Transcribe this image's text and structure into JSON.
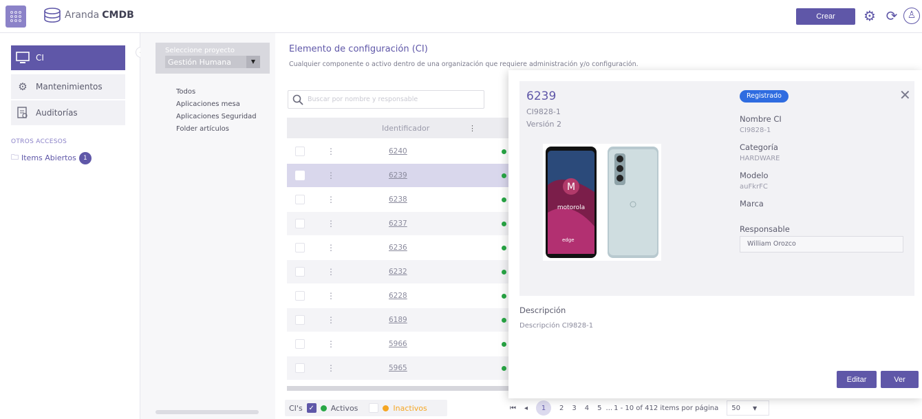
{
  "header": {
    "brand_prefix": "Aranda",
    "brand_bold": "CMDB",
    "create_label": "Crear"
  },
  "sidebar": {
    "items": [
      {
        "label": "CI",
        "icon": "monitor-icon",
        "active": true
      },
      {
        "label": "Mantenimientos",
        "icon": "gears-icon",
        "active": false
      },
      {
        "label": "Auditorías",
        "icon": "audit-icon",
        "active": false
      }
    ],
    "otros_label": "OTROS ACCESOS",
    "items_abiertos_label": "Items Abiertos",
    "items_abiertos_count": "1"
  },
  "projects": {
    "select_label": "Seleccione proyecto",
    "select_value": "Gestión Humana",
    "list": [
      "Todos",
      "Aplicaciones mesa",
      "Aplicaciones Seguridad",
      "Folder artículos"
    ]
  },
  "main": {
    "title": "Elemento de configuración (CI)",
    "subtitle": "Cualquier componente o activo dentro de una organización que requiere administración y/o configuración.",
    "search_placeholder": "Buscar por nombre y responsable",
    "col_identifier": "Identificador",
    "rows": [
      "6240",
      "6239",
      "6238",
      "6237",
      "6236",
      "6232",
      "6228",
      "6189",
      "5966",
      "5965"
    ],
    "selected_row": "6239"
  },
  "footer": {
    "cis_label": "CI's",
    "activos_label": "Activos",
    "inactivos_label": "Inactivos",
    "pages": [
      "1",
      "2",
      "3",
      "4",
      "5"
    ],
    "ellipsis": "...",
    "range_text": "1 - 10 of 412 items por página",
    "per_page": "50"
  },
  "detail": {
    "id": "6239",
    "code": "CI9828-1",
    "version": "Versión 2",
    "status": "Registrado",
    "nombre_label": "Nombre CI",
    "nombre_value": "CI9828-1",
    "categoria_label": "Categoría",
    "categoria_value": "HARDWARE",
    "modelo_label": "Modelo",
    "modelo_value": "auFkrFC",
    "marca_label": "Marca",
    "responsable_label": "Responsable",
    "responsable_value": "William Orozco",
    "descripcion_label": "Descripción",
    "descripcion_value": "Descripción CI9828-1",
    "edit_label": "Editar",
    "ver_label": "Ver"
  },
  "colors": {
    "accent": "#5f57a8",
    "status_blue": "#2f6ce0",
    "active_green": "#28a745",
    "inactive_orange": "#f5a623"
  }
}
